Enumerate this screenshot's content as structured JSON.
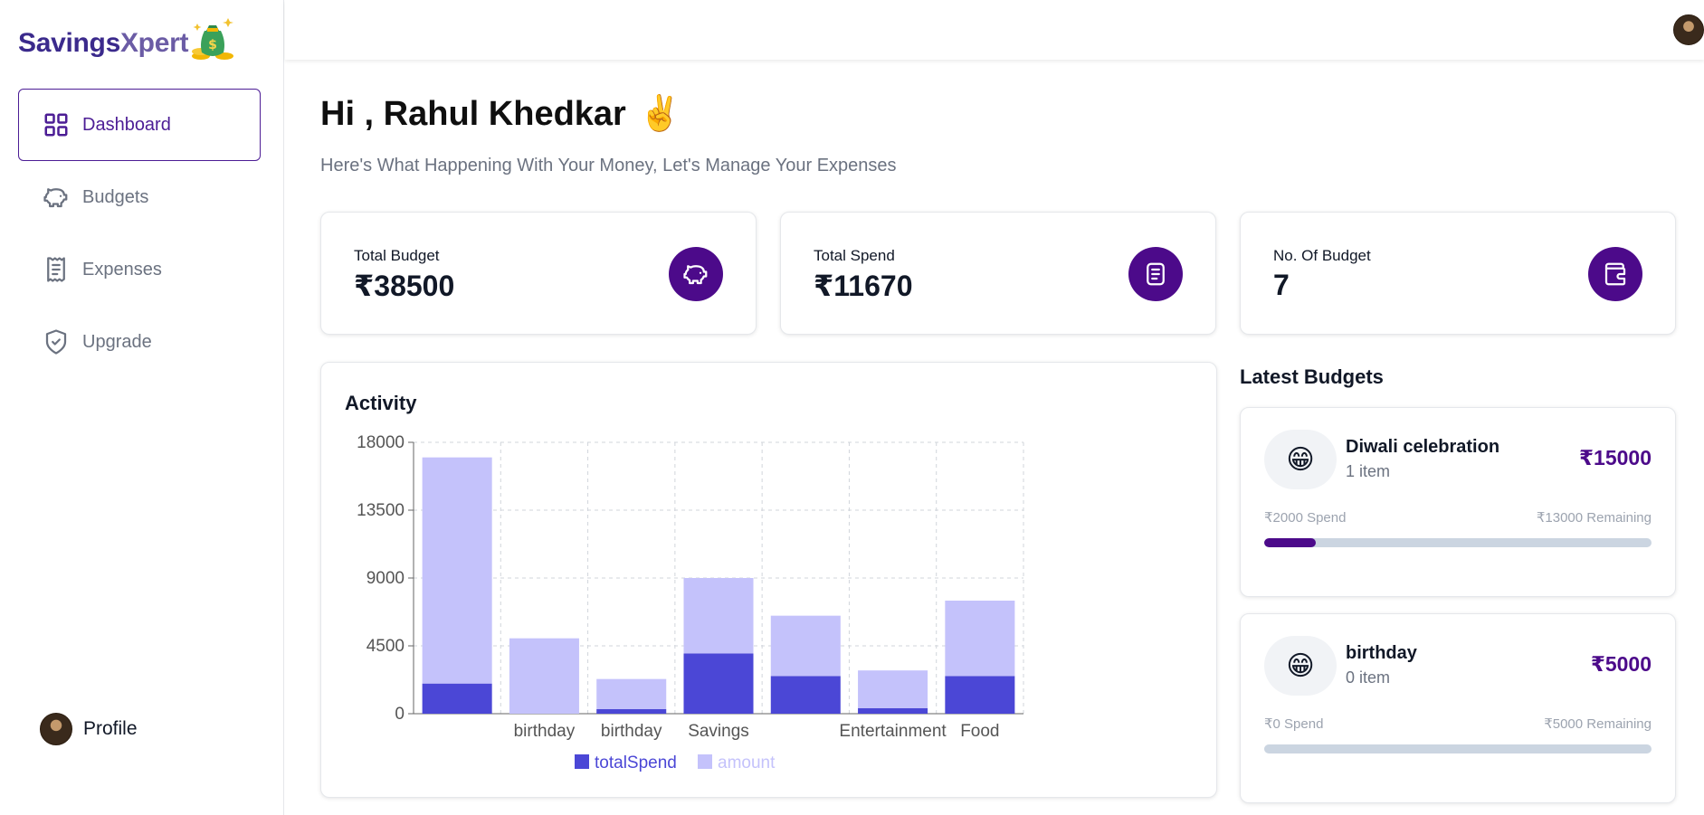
{
  "app": {
    "logo_part1": "Savings",
    "logo_part2": "Xpert",
    "logo_icon": "money-bag-icon"
  },
  "sidebar": {
    "items": [
      {
        "label": "Dashboard",
        "icon": "grid-icon",
        "active": true
      },
      {
        "label": "Budgets",
        "icon": "piggy-bank-icon",
        "active": false
      },
      {
        "label": "Expenses",
        "icon": "receipt-icon",
        "active": false
      },
      {
        "label": "Upgrade",
        "icon": "shield-check-icon",
        "active": false
      }
    ],
    "profile_label": "Profile"
  },
  "header": {
    "greeting": "Hi , Rahul Khedkar",
    "greeting_emoji": "✌️",
    "subtitle": "Here's What Happening With Your Money, Let's Manage Your Expenses"
  },
  "stats": [
    {
      "label": "Total Budget",
      "value": "₹38500",
      "icon": "piggy-bank-icon"
    },
    {
      "label": "Total Spend",
      "value": "₹11670",
      "icon": "receipt-icon"
    },
    {
      "label": "No. Of Budget",
      "value": "7",
      "icon": "wallet-icon"
    }
  ],
  "activity": {
    "title": "Activity"
  },
  "chart_data": {
    "type": "bar",
    "stacked": true,
    "categories": [
      "",
      "birthday",
      "birthday",
      "Savings",
      "",
      "Entertainment",
      "Food"
    ],
    "series": [
      {
        "name": "totalSpend",
        "values": [
          2000,
          0,
          300,
          4000,
          2500,
          370,
          2500
        ],
        "color": "#4b47d6"
      },
      {
        "name": "amount",
        "values": [
          15000,
          5000,
          2000,
          5000,
          4000,
          2500,
          5000
        ],
        "color": "#c4c2fb"
      }
    ],
    "ylim": [
      0,
      18000
    ],
    "yticks": [
      "0",
      "4500",
      "9000",
      "13500",
      "18000"
    ],
    "grid": true,
    "legend": "bottom"
  },
  "latest": {
    "title": "Latest Budgets",
    "budgets": [
      {
        "emoji": "😁",
        "name": "Diwali celebration",
        "items": "1 item",
        "amount": "₹15000",
        "spend": "₹2000 Spend",
        "remaining": "₹13000 Remaining",
        "progress": 0.133
      },
      {
        "emoji": "😁",
        "name": "birthday",
        "items": "0 item",
        "amount": "₹5000",
        "spend": "₹0 Spend",
        "remaining": "₹5000 Remaining",
        "progress": 0
      }
    ]
  },
  "colors": {
    "brand": "#4c0a8a",
    "active_nav": "#4c1d95",
    "spend_bar": "#4b47d6",
    "amount_bar": "#c4c2fb"
  }
}
